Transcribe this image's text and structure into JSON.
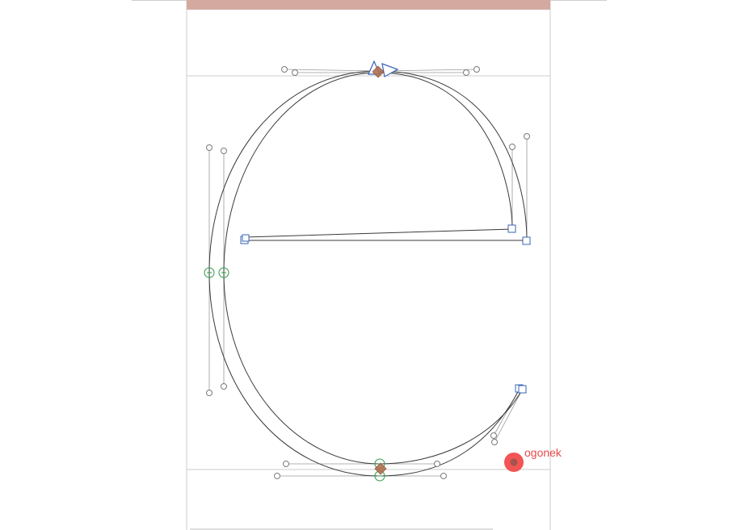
{
  "editor": {
    "glyph_char": "e",
    "anchor_name": "ogonek",
    "colors": {
      "outline": "#3a3a3a",
      "handle_line": "#9a9a9a",
      "corner_node": "#3a64b4",
      "smooth_node": "#2e9a4a",
      "start_node": "#b07050",
      "anchor": "#f04848",
      "metric_line": "#c8c8c8",
      "top_bar": "#d4aaa0"
    },
    "icons": {
      "corner_node": "square-node-icon",
      "smooth_node": "circle-node-icon",
      "start_node": "diamond-start-icon",
      "direction": "direction-arrow-icon",
      "anchor": "anchor-dot-icon"
    }
  }
}
